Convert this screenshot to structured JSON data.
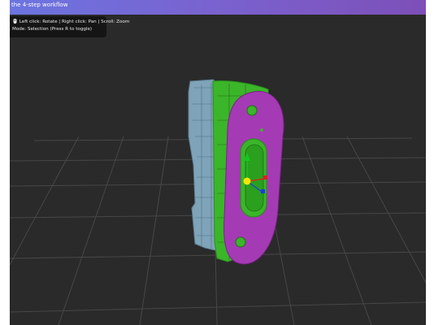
{
  "banner": {
    "text": "the 4-step workflow"
  },
  "hud": {
    "controls_text": "🖱️ Left click: Rotate | Right click: Pan | Scroll: Zoom",
    "mode_text": "Mode: Selection (Press R to toggle)"
  },
  "colors": {
    "background": "#2a2a2a",
    "grid": "#4a4a4a",
    "mesh_blue": "#7fa3b8",
    "face_green": "#3bb52a",
    "face_magenta": "#a43bb4",
    "gizmo_center": "#f2e600",
    "axis_x": "#e11d1d",
    "axis_y": "#14c81e",
    "axis_z": "#1e3be6"
  },
  "icons": {
    "mouse": "mouse-icon",
    "transform_gizmo": "transform-gizmo-icon"
  }
}
